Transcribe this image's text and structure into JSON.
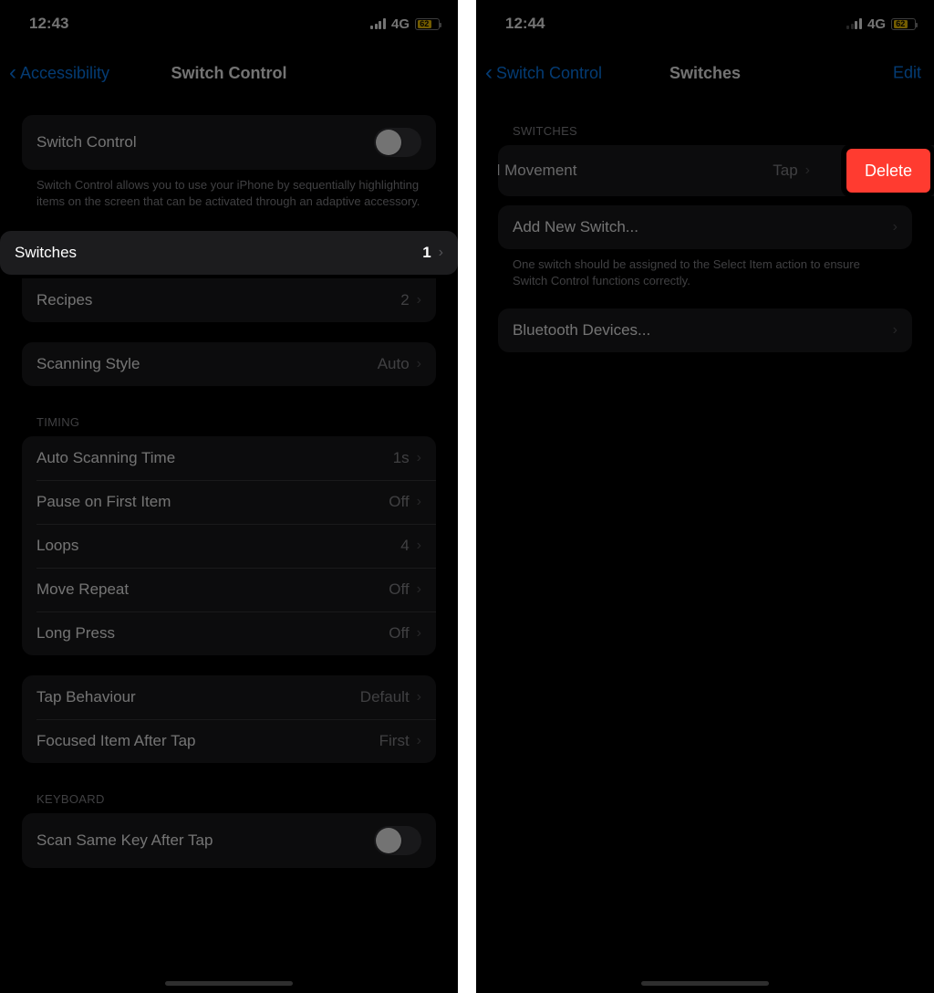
{
  "left": {
    "status": {
      "time": "12:43",
      "network": "4G",
      "battery": "62"
    },
    "nav": {
      "back": "Accessibility",
      "title": "Switch Control"
    },
    "switchControl": {
      "toggle_label": "Switch Control",
      "desc": "Switch Control allows you to use your iPhone by sequentially highlighting items on the screen that can be activated through an adaptive accessory."
    },
    "config": {
      "switches_label": "Switches",
      "switches_count": "1",
      "recipes_label": "Recipes",
      "recipes_count": "2"
    },
    "scanning": {
      "style_label": "Scanning Style",
      "style_value": "Auto"
    },
    "timing": {
      "header": "TIMING",
      "auto_label": "Auto Scanning Time",
      "auto_value": "1s",
      "pause_label": "Pause on First Item",
      "pause_value": "Off",
      "loops_label": "Loops",
      "loops_value": "4",
      "move_label": "Move Repeat",
      "move_value": "Off",
      "long_label": "Long Press",
      "long_value": "Off"
    },
    "tap": {
      "behaviour_label": "Tap Behaviour",
      "behaviour_value": "Default",
      "focused_label": "Focused Item After Tap",
      "focused_value": "First"
    },
    "keyboard": {
      "header": "KEYBOARD",
      "scan_label": "Scan Same Key After Tap"
    }
  },
  "right": {
    "status": {
      "time": "12:44",
      "network": "4G",
      "battery": "62"
    },
    "nav": {
      "back": "Switch Control",
      "title": "Switches",
      "action": "Edit"
    },
    "switches": {
      "header": "SWITCHES",
      "item_label": "ead Movement",
      "item_value": "Tap",
      "delete": "Delete",
      "add_label": "Add New Switch...",
      "footer": "One switch should be assigned to the Select Item action to ensure Switch Control functions correctly."
    },
    "bluetooth": {
      "label": "Bluetooth Devices..."
    }
  }
}
